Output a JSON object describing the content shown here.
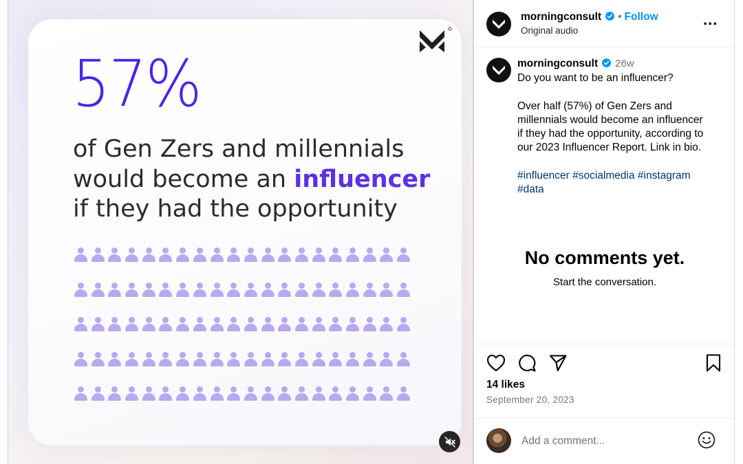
{
  "media": {
    "stat": "57%",
    "headline_line1": "of Gen Zers and millennials",
    "headline_line2_prefix": "would become an ",
    "headline_line2_accent": "influencer",
    "headline_line3": "if they had the opportunity",
    "people_rows": 5,
    "people_per_row": 20,
    "accent_color": "#4b24e6",
    "icon_color": "#b9a9ef",
    "mute_icon": "speaker-muted-icon"
  },
  "header": {
    "username": "morningconsult",
    "separator": "•",
    "follow_label": "Follow",
    "audio_label": "Original audio",
    "more_label": "..."
  },
  "caption": {
    "username": "morningconsult",
    "time_ago": "26w",
    "lines": [
      "Do you want to be an influencer?",
      "Over half (57%) of Gen Zers and",
      "millennials would become an influencer",
      "if they had the opportunity, according to",
      "our 2023 Influencer Report. Link in bio."
    ],
    "hashtag_line1": "#influencer #socialmedia #instagram",
    "hashtag_line2": "#data"
  },
  "comments": {
    "empty_title": "No comments yet.",
    "empty_subtitle": "Start the conversation."
  },
  "actions": {
    "icons": [
      "heart-icon",
      "comment-icon",
      "share-icon",
      "bookmark-icon"
    ],
    "likes": "14 likes",
    "date": "September 20, 2023"
  },
  "comment_box": {
    "placeholder": "Add a comment...",
    "value": ""
  },
  "colors": {
    "link_blue": "#0095f6",
    "hashtag_blue": "#00376b",
    "muted_text": "#737373"
  }
}
